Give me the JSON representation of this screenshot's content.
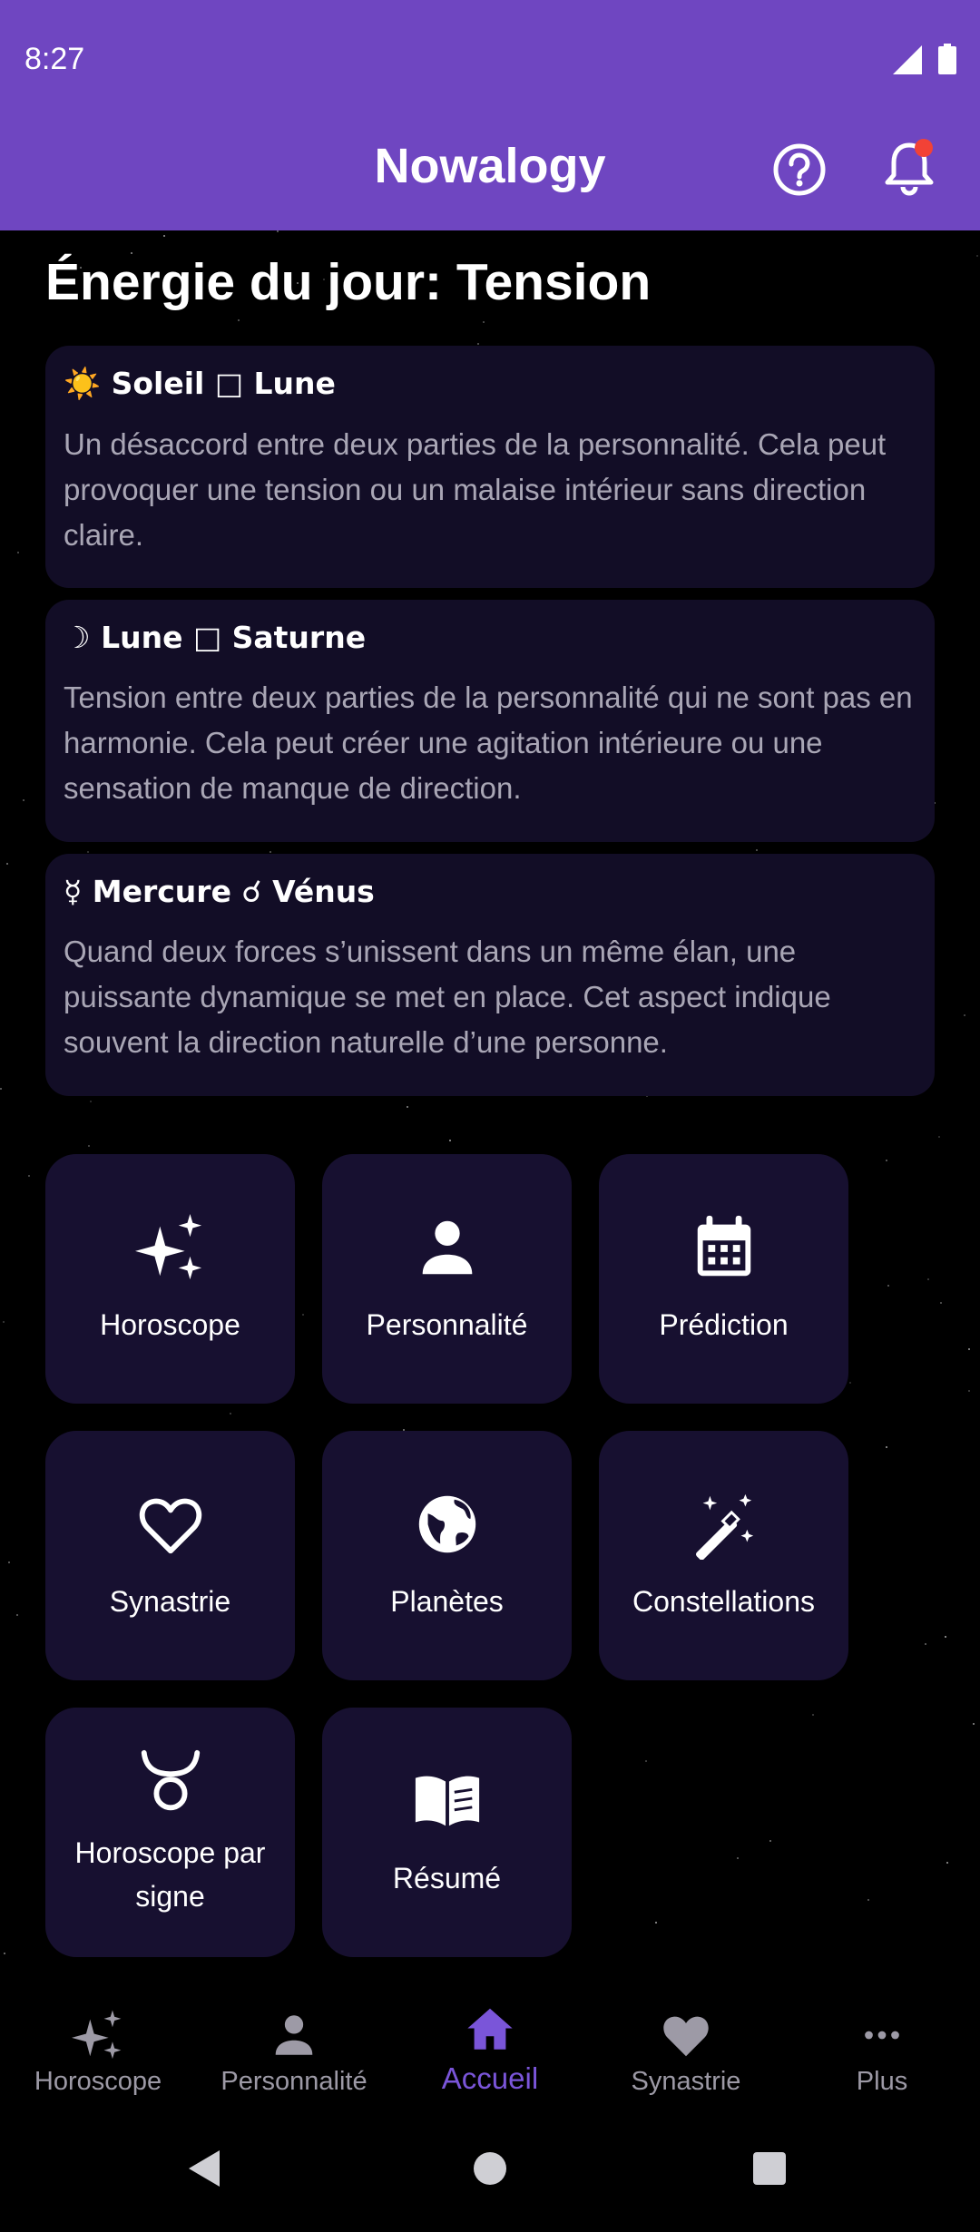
{
  "status_bar": {
    "time": "8:27"
  },
  "app_bar": {
    "title": "Nowalogy"
  },
  "section": {
    "title": "Énergie du jour: Tension"
  },
  "aspects": [
    {
      "title": "☀️ Soleil □ Lune",
      "text": "Un désaccord entre deux parties de la personnalité. Cela peut provoquer une tension ou un malaise intérieur sans direction claire."
    },
    {
      "title": "☽ Lune □ Saturne",
      "text": "Tension entre deux parties de la personnalité qui ne sont pas en harmonie. Cela peut créer une agitation intérieure ou une sensation de manque de direction."
    },
    {
      "title": "☿ Mercure ☌ Vénus",
      "text": "Quand deux forces s’unissent dans un même élan, une puissante dynamique se met en place. Cet aspect indique souvent la direction naturelle d’une personne."
    }
  ],
  "tiles": [
    {
      "label": "Horoscope",
      "icon": "sparkles-icon"
    },
    {
      "label": "Personnalité",
      "icon": "person-icon"
    },
    {
      "label": "Prédiction",
      "icon": "calendar-icon"
    },
    {
      "label": "Synastrie",
      "icon": "heart-outline-icon"
    },
    {
      "label": "Planètes",
      "icon": "globe-icon"
    },
    {
      "label": "Constellations",
      "icon": "magic-wand-icon"
    },
    {
      "label": "Horoscope par signe",
      "icon": "taurus-icon"
    },
    {
      "label": "Résumé",
      "icon": "book-icon"
    }
  ],
  "bottom_nav": {
    "items": [
      {
        "label": "Horoscope",
        "icon": "sparkles-icon"
      },
      {
        "label": "Personnalité",
        "icon": "person-icon"
      },
      {
        "label": "Accueil",
        "icon": "home-icon",
        "active": true
      },
      {
        "label": "Synastrie",
        "icon": "heart-icon"
      },
      {
        "label": "Plus",
        "icon": "more-horiz-icon"
      }
    ]
  },
  "colors": {
    "app_bar": "#6f46c1",
    "accent": "#7a55d9",
    "card": "#120d26",
    "tile": "#171030",
    "notification_dot": "#f24236"
  }
}
